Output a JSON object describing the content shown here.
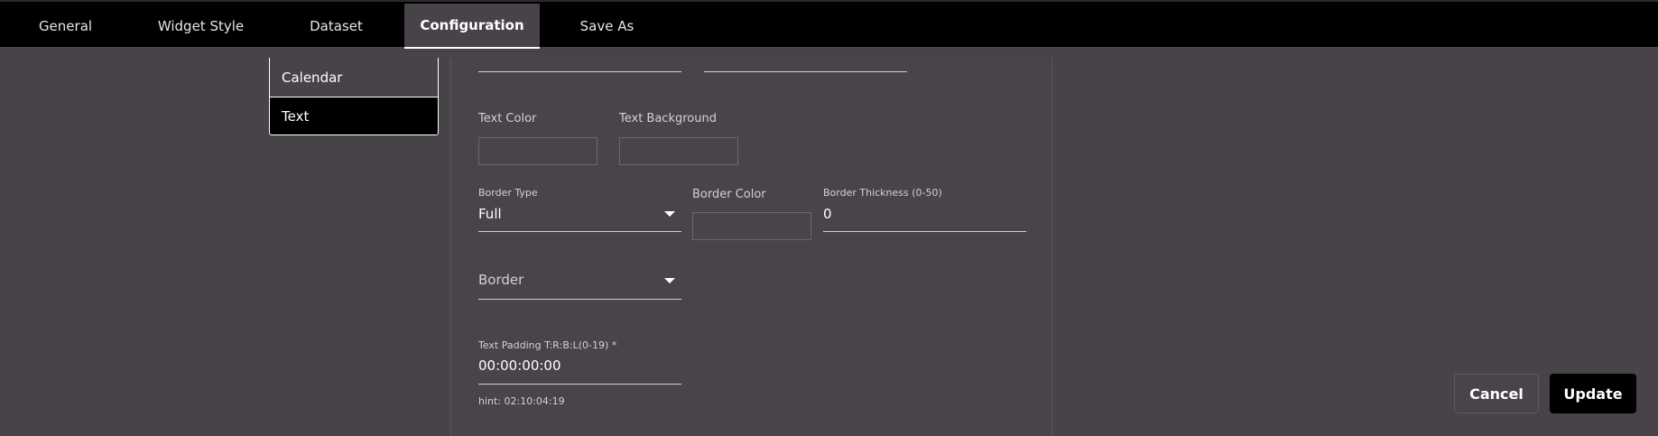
{
  "tabs": [
    {
      "label": "General"
    },
    {
      "label": "Widget Style"
    },
    {
      "label": "Dataset"
    },
    {
      "label": "Configuration"
    },
    {
      "label": "Save As"
    }
  ],
  "sidebar": {
    "items": [
      {
        "label": "Calendar"
      },
      {
        "label": "Text"
      }
    ]
  },
  "form": {
    "text_color_label": "Text Color",
    "text_background_label": "Text Background",
    "border_type_label": "Border Type",
    "border_type_value": "Full",
    "border_color_label": "Border Color",
    "border_thickness_label": "Border Thickness (0-50)",
    "border_thickness_value": "0",
    "border_select_placeholder": "Border",
    "text_padding_label": "Text Padding T:R:B:L(0-19) *",
    "text_padding_value": "00:00:00:00",
    "text_padding_hint": "hint: 02:10:04:19"
  },
  "actions": {
    "cancel_label": "Cancel",
    "update_label": "Update"
  }
}
